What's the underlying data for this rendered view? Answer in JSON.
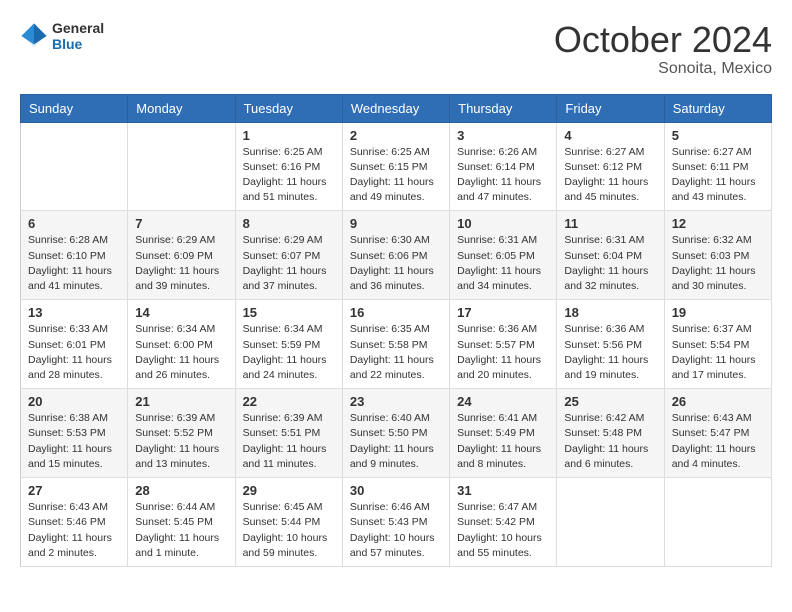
{
  "header": {
    "logo_general": "General",
    "logo_blue": "Blue",
    "month_year": "October 2024",
    "location": "Sonoita, Mexico"
  },
  "days_of_week": [
    "Sunday",
    "Monday",
    "Tuesday",
    "Wednesday",
    "Thursday",
    "Friday",
    "Saturday"
  ],
  "weeks": [
    [
      {
        "day": "",
        "sunrise": "",
        "sunset": "",
        "daylight": ""
      },
      {
        "day": "",
        "sunrise": "",
        "sunset": "",
        "daylight": ""
      },
      {
        "day": "1",
        "sunrise": "Sunrise: 6:25 AM",
        "sunset": "Sunset: 6:16 PM",
        "daylight": "Daylight: 11 hours and 51 minutes."
      },
      {
        "day": "2",
        "sunrise": "Sunrise: 6:25 AM",
        "sunset": "Sunset: 6:15 PM",
        "daylight": "Daylight: 11 hours and 49 minutes."
      },
      {
        "day": "3",
        "sunrise": "Sunrise: 6:26 AM",
        "sunset": "Sunset: 6:14 PM",
        "daylight": "Daylight: 11 hours and 47 minutes."
      },
      {
        "day": "4",
        "sunrise": "Sunrise: 6:27 AM",
        "sunset": "Sunset: 6:12 PM",
        "daylight": "Daylight: 11 hours and 45 minutes."
      },
      {
        "day": "5",
        "sunrise": "Sunrise: 6:27 AM",
        "sunset": "Sunset: 6:11 PM",
        "daylight": "Daylight: 11 hours and 43 minutes."
      }
    ],
    [
      {
        "day": "6",
        "sunrise": "Sunrise: 6:28 AM",
        "sunset": "Sunset: 6:10 PM",
        "daylight": "Daylight: 11 hours and 41 minutes."
      },
      {
        "day": "7",
        "sunrise": "Sunrise: 6:29 AM",
        "sunset": "Sunset: 6:09 PM",
        "daylight": "Daylight: 11 hours and 39 minutes."
      },
      {
        "day": "8",
        "sunrise": "Sunrise: 6:29 AM",
        "sunset": "Sunset: 6:07 PM",
        "daylight": "Daylight: 11 hours and 37 minutes."
      },
      {
        "day": "9",
        "sunrise": "Sunrise: 6:30 AM",
        "sunset": "Sunset: 6:06 PM",
        "daylight": "Daylight: 11 hours and 36 minutes."
      },
      {
        "day": "10",
        "sunrise": "Sunrise: 6:31 AM",
        "sunset": "Sunset: 6:05 PM",
        "daylight": "Daylight: 11 hours and 34 minutes."
      },
      {
        "day": "11",
        "sunrise": "Sunrise: 6:31 AM",
        "sunset": "Sunset: 6:04 PM",
        "daylight": "Daylight: 11 hours and 32 minutes."
      },
      {
        "day": "12",
        "sunrise": "Sunrise: 6:32 AM",
        "sunset": "Sunset: 6:03 PM",
        "daylight": "Daylight: 11 hours and 30 minutes."
      }
    ],
    [
      {
        "day": "13",
        "sunrise": "Sunrise: 6:33 AM",
        "sunset": "Sunset: 6:01 PM",
        "daylight": "Daylight: 11 hours and 28 minutes."
      },
      {
        "day": "14",
        "sunrise": "Sunrise: 6:34 AM",
        "sunset": "Sunset: 6:00 PM",
        "daylight": "Daylight: 11 hours and 26 minutes."
      },
      {
        "day": "15",
        "sunrise": "Sunrise: 6:34 AM",
        "sunset": "Sunset: 5:59 PM",
        "daylight": "Daylight: 11 hours and 24 minutes."
      },
      {
        "day": "16",
        "sunrise": "Sunrise: 6:35 AM",
        "sunset": "Sunset: 5:58 PM",
        "daylight": "Daylight: 11 hours and 22 minutes."
      },
      {
        "day": "17",
        "sunrise": "Sunrise: 6:36 AM",
        "sunset": "Sunset: 5:57 PM",
        "daylight": "Daylight: 11 hours and 20 minutes."
      },
      {
        "day": "18",
        "sunrise": "Sunrise: 6:36 AM",
        "sunset": "Sunset: 5:56 PM",
        "daylight": "Daylight: 11 hours and 19 minutes."
      },
      {
        "day": "19",
        "sunrise": "Sunrise: 6:37 AM",
        "sunset": "Sunset: 5:54 PM",
        "daylight": "Daylight: 11 hours and 17 minutes."
      }
    ],
    [
      {
        "day": "20",
        "sunrise": "Sunrise: 6:38 AM",
        "sunset": "Sunset: 5:53 PM",
        "daylight": "Daylight: 11 hours and 15 minutes."
      },
      {
        "day": "21",
        "sunrise": "Sunrise: 6:39 AM",
        "sunset": "Sunset: 5:52 PM",
        "daylight": "Daylight: 11 hours and 13 minutes."
      },
      {
        "day": "22",
        "sunrise": "Sunrise: 6:39 AM",
        "sunset": "Sunset: 5:51 PM",
        "daylight": "Daylight: 11 hours and 11 minutes."
      },
      {
        "day": "23",
        "sunrise": "Sunrise: 6:40 AM",
        "sunset": "Sunset: 5:50 PM",
        "daylight": "Daylight: 11 hours and 9 minutes."
      },
      {
        "day": "24",
        "sunrise": "Sunrise: 6:41 AM",
        "sunset": "Sunset: 5:49 PM",
        "daylight": "Daylight: 11 hours and 8 minutes."
      },
      {
        "day": "25",
        "sunrise": "Sunrise: 6:42 AM",
        "sunset": "Sunset: 5:48 PM",
        "daylight": "Daylight: 11 hours and 6 minutes."
      },
      {
        "day": "26",
        "sunrise": "Sunrise: 6:43 AM",
        "sunset": "Sunset: 5:47 PM",
        "daylight": "Daylight: 11 hours and 4 minutes."
      }
    ],
    [
      {
        "day": "27",
        "sunrise": "Sunrise: 6:43 AM",
        "sunset": "Sunset: 5:46 PM",
        "daylight": "Daylight: 11 hours and 2 minutes."
      },
      {
        "day": "28",
        "sunrise": "Sunrise: 6:44 AM",
        "sunset": "Sunset: 5:45 PM",
        "daylight": "Daylight: 11 hours and 1 minute."
      },
      {
        "day": "29",
        "sunrise": "Sunrise: 6:45 AM",
        "sunset": "Sunset: 5:44 PM",
        "daylight": "Daylight: 10 hours and 59 minutes."
      },
      {
        "day": "30",
        "sunrise": "Sunrise: 6:46 AM",
        "sunset": "Sunset: 5:43 PM",
        "daylight": "Daylight: 10 hours and 57 minutes."
      },
      {
        "day": "31",
        "sunrise": "Sunrise: 6:47 AM",
        "sunset": "Sunset: 5:42 PM",
        "daylight": "Daylight: 10 hours and 55 minutes."
      },
      {
        "day": "",
        "sunrise": "",
        "sunset": "",
        "daylight": ""
      },
      {
        "day": "",
        "sunrise": "",
        "sunset": "",
        "daylight": ""
      }
    ]
  ]
}
